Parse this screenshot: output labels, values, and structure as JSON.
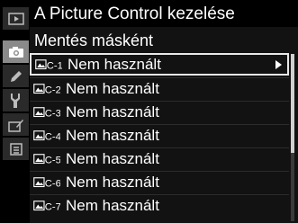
{
  "header": {
    "title": "A Picture Control kezelése"
  },
  "menu": {
    "subtitle": "Mentés másként",
    "items": [
      {
        "code": "C-1",
        "label": "Nem használt",
        "selected": true
      },
      {
        "code": "C-2",
        "label": "Nem használt"
      },
      {
        "code": "C-3",
        "label": "Nem használt"
      },
      {
        "code": "C-4",
        "label": "Nem használt"
      },
      {
        "code": "C-5",
        "label": "Nem használt"
      },
      {
        "code": "C-6",
        "label": "Nem használt"
      },
      {
        "code": "C-7",
        "label": "Nem használt"
      }
    ]
  },
  "sidebar": {
    "tabs": [
      {
        "icon": "playback-icon"
      },
      {
        "icon": "camera-icon",
        "active": true
      },
      {
        "icon": "pencil-icon"
      },
      {
        "icon": "wrench-icon"
      },
      {
        "icon": "retouch-icon"
      },
      {
        "icon": "my-menu-icon"
      }
    ]
  },
  "colors": {
    "background": "#000000",
    "panel": "#121212",
    "sidebar_active": "#8a8a8a",
    "text": "#ffffff"
  }
}
